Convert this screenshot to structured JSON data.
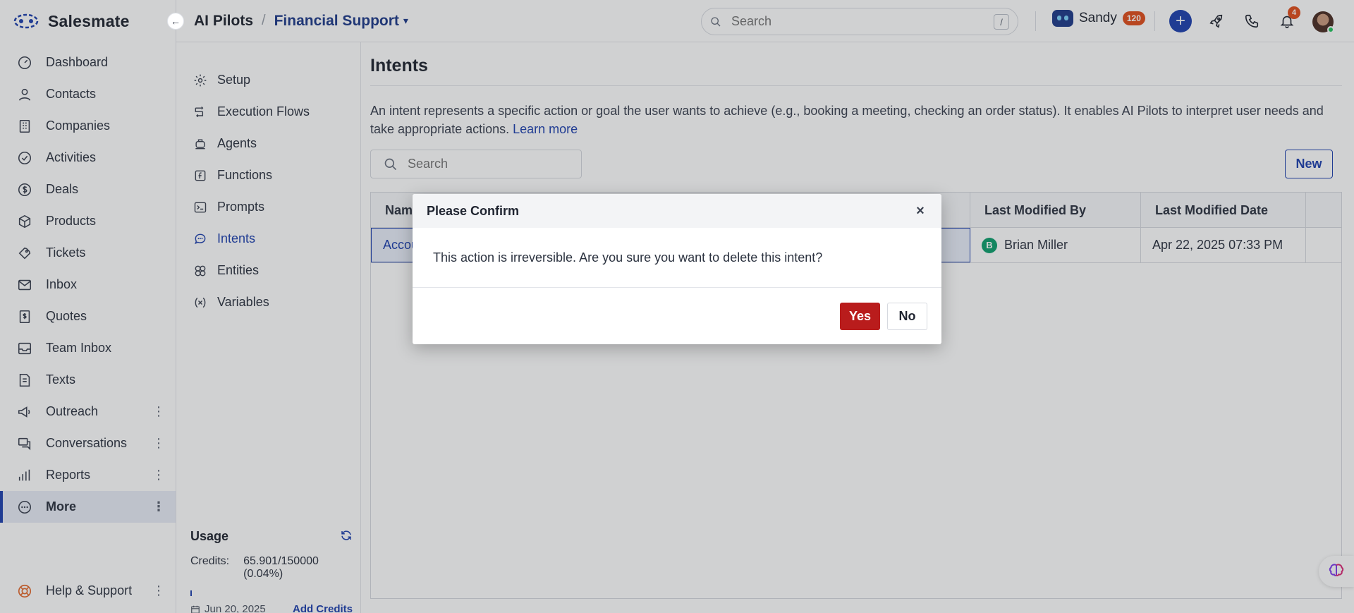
{
  "brand": {
    "name": "Salesmate",
    "logo_icon": "salesmate-logo-icon"
  },
  "nav": {
    "items": [
      {
        "label": "Dashboard",
        "icon": "dashboard-icon",
        "has_menu": false
      },
      {
        "label": "Contacts",
        "icon": "user-icon",
        "has_menu": false
      },
      {
        "label": "Companies",
        "icon": "building-icon",
        "has_menu": false
      },
      {
        "label": "Activities",
        "icon": "check-circle-icon",
        "has_menu": false
      },
      {
        "label": "Deals",
        "icon": "dollar-circle-icon",
        "has_menu": false
      },
      {
        "label": "Products",
        "icon": "box-icon",
        "has_menu": false
      },
      {
        "label": "Tickets",
        "icon": "ticket-icon",
        "has_menu": false
      },
      {
        "label": "Inbox",
        "icon": "mail-icon",
        "has_menu": false
      },
      {
        "label": "Quotes",
        "icon": "quote-icon",
        "has_menu": false
      },
      {
        "label": "Team Inbox",
        "icon": "tray-icon",
        "has_menu": false
      },
      {
        "label": "Texts",
        "icon": "text-message-icon",
        "has_menu": false
      },
      {
        "label": "Outreach",
        "icon": "megaphone-icon",
        "has_menu": true
      },
      {
        "label": "Conversations",
        "icon": "chat-icon",
        "has_menu": true
      },
      {
        "label": "Reports",
        "icon": "bar-chart-icon",
        "has_menu": true
      },
      {
        "label": "More",
        "icon": "more-circle-icon",
        "has_menu": true,
        "active": true
      }
    ],
    "help": {
      "label": "Help & Support",
      "icon": "lifebuoy-icon"
    }
  },
  "topbar": {
    "breadcrumb_root": "AI Pilots",
    "breadcrumb_separator": "/",
    "breadcrumb_current": "Financial Support",
    "search_placeholder": "Search",
    "search_shortcut": "/",
    "user_name": "Sandy",
    "user_badge": "120",
    "notification_count": "4"
  },
  "subnav": {
    "items": [
      {
        "label": "Setup",
        "icon": "gear-icon"
      },
      {
        "label": "Execution Flows",
        "icon": "flow-icon"
      },
      {
        "label": "Agents",
        "icon": "agent-icon"
      },
      {
        "label": "Functions",
        "icon": "function-icon"
      },
      {
        "label": "Prompts",
        "icon": "terminal-icon"
      },
      {
        "label": "Intents",
        "icon": "intent-chat-icon",
        "active": true
      },
      {
        "label": "Entities",
        "icon": "entities-icon"
      },
      {
        "label": "Variables",
        "icon": "variable-icon"
      }
    ],
    "usage": {
      "title": "Usage",
      "credits_label": "Credits:",
      "credits_value": "65.901/150000 (0.04%)",
      "progress_percent": 0.04,
      "date": "Jun 20, 2025",
      "add_credits": "Add Credits"
    }
  },
  "main": {
    "title": "Intents",
    "description": "An intent represents a specific action or goal the user wants to achieve (e.g., booking a meeting, checking an order status). It enables AI Pilots to interpret user needs and take appropriate actions.",
    "learn_more": "Learn more",
    "search_placeholder": "Search",
    "new_button": "New",
    "table": {
      "columns": [
        "Name",
        "Last Modified By",
        "Last Modified Date"
      ],
      "rows": [
        {
          "name": "Accou",
          "modified_by_initial": "B",
          "modified_by": "Brian Miller",
          "modified_date": "Apr 22, 2025 07:33 PM"
        }
      ]
    }
  },
  "modal": {
    "title": "Please Confirm",
    "close": "×",
    "message": "This action is irreversible. Are you sure you want to delete this intent?",
    "yes": "Yes",
    "no": "No"
  },
  "colors": {
    "accent": "#1e40af",
    "danger": "#b91c1c",
    "badge": "#e04e1c",
    "avatar_green": "#0e9f6e"
  }
}
